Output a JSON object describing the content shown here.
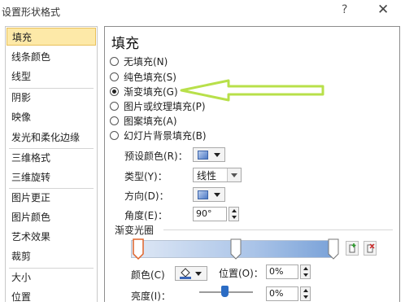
{
  "window": {
    "title": "设置形状格式",
    "help": "?",
    "close": "✕"
  },
  "sidebar": {
    "items": [
      {
        "label": "填充",
        "selected": true
      },
      {
        "label": "线条颜色"
      },
      {
        "label": "线型"
      },
      {
        "label": "阴影"
      },
      {
        "label": "映像"
      },
      {
        "label": "发光和柔化边缘"
      },
      {
        "label": "三维格式"
      },
      {
        "label": "三维旋转"
      },
      {
        "label": "图片更正"
      },
      {
        "label": "图片颜色"
      },
      {
        "label": "艺术效果"
      },
      {
        "label": "裁剪"
      },
      {
        "label": "大小"
      },
      {
        "label": "位置"
      }
    ]
  },
  "panel": {
    "title": "填充",
    "options": [
      {
        "label": "无填充(N)",
        "checked": false
      },
      {
        "label": "纯色填充(S)",
        "checked": false
      },
      {
        "label": "渐变填充(G)",
        "checked": true
      },
      {
        "label": "图片或纹理填充(P)",
        "checked": false
      },
      {
        "label": "图案填充(A)",
        "checked": false
      },
      {
        "label": "幻灯片背景填充(B)",
        "checked": false
      }
    ],
    "preset_label": "预设颜色(R)：",
    "type_label": "类型(Y)：",
    "type_value": "线性",
    "direction_label": "方向(D)：",
    "angle_label": "角度(E)：",
    "angle_value": "90°",
    "gradient_stops_label": "渐变光圈",
    "color_label": "颜色(C)",
    "position_label": "位置(O)：",
    "position_value": "0%",
    "brightness_label": "亮度(I)：",
    "brightness_value": "0%"
  },
  "colors": {
    "selected_bg": "#fde9a8",
    "annotation_arrow": "#b8e04a",
    "stop_selected": "#e0642a"
  }
}
